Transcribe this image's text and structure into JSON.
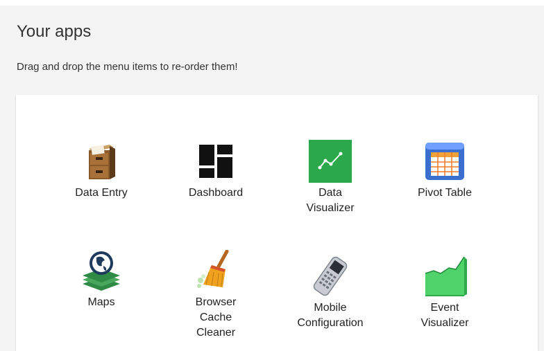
{
  "header": {
    "title": "Your apps",
    "subtitle": "Drag and drop the menu items to re-order them!"
  },
  "apps": [
    {
      "label_lines": [
        "Data Entry"
      ],
      "icon": "file-cabinet-icon"
    },
    {
      "label_lines": [
        "Dashboard"
      ],
      "icon": "dashboard-grid-icon"
    },
    {
      "label_lines": [
        "Data",
        "Visualizer"
      ],
      "icon": "line-chart-icon",
      "accent": "#2aa84a"
    },
    {
      "label_lines": [
        "Pivot Table"
      ],
      "icon": "pivot-table-icon",
      "accent": "#3a6fd0"
    },
    {
      "label_lines": [
        "Maps"
      ],
      "icon": "globe-layers-icon",
      "accent": "#2b7a3e"
    },
    {
      "label_lines": [
        "Browser",
        "Cache",
        "Cleaner"
      ],
      "icon": "broom-icon",
      "accent": "#e09a1e"
    },
    {
      "label_lines": [
        "Mobile",
        "Configuration"
      ],
      "icon": "mobile-phone-icon"
    },
    {
      "label_lines": [
        "Event",
        "Visualizer"
      ],
      "icon": "area-chart-icon",
      "accent": "#4fd26a"
    }
  ]
}
